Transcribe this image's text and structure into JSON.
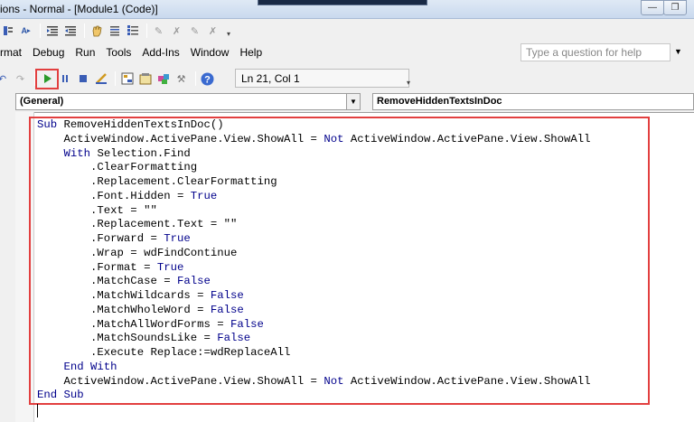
{
  "window": {
    "title": "ions - Normal - [Module1 (Code)]",
    "controls": [
      "minimize",
      "restore"
    ]
  },
  "menu": {
    "items": [
      "rmat",
      "Debug",
      "Run",
      "Tools",
      "Add-Ins",
      "Window",
      "Help"
    ]
  },
  "help": {
    "placeholder": "Type a question for help"
  },
  "status": {
    "position": "Ln 21, Col 1"
  },
  "combos": {
    "object": "(General)",
    "procedure": "RemoveHiddenTextsInDoc"
  },
  "code": {
    "lines": [
      [
        {
          "t": "Sub ",
          "k": true
        },
        {
          "t": "RemoveHiddenTextsInDoc()",
          "k": false
        }
      ],
      [
        {
          "t": "    ActiveWindow.ActivePane.View.ShowAll = ",
          "k": false
        },
        {
          "t": "Not",
          "k": true
        },
        {
          "t": " ActiveWindow.ActivePane.View.ShowAll",
          "k": false
        }
      ],
      [
        {
          "t": "    ",
          "k": false
        },
        {
          "t": "With",
          "k": true
        },
        {
          "t": " Selection.Find",
          "k": false
        }
      ],
      [
        {
          "t": "        .ClearFormatting",
          "k": false
        }
      ],
      [
        {
          "t": "        .Replacement.ClearFormatting",
          "k": false
        }
      ],
      [
        {
          "t": "        .Font.Hidden = ",
          "k": false
        },
        {
          "t": "True",
          "k": true
        }
      ],
      [
        {
          "t": "        .Text = \"\"",
          "k": false
        }
      ],
      [
        {
          "t": "        .Replacement.Text = \"\"",
          "k": false
        }
      ],
      [
        {
          "t": "        .Forward = ",
          "k": false
        },
        {
          "t": "True",
          "k": true
        }
      ],
      [
        {
          "t": "        .Wrap = wdFindContinue",
          "k": false
        }
      ],
      [
        {
          "t": "        .Format = ",
          "k": false
        },
        {
          "t": "True",
          "k": true
        }
      ],
      [
        {
          "t": "        .MatchCase = ",
          "k": false
        },
        {
          "t": "False",
          "k": true
        }
      ],
      [
        {
          "t": "        .MatchWildcards = ",
          "k": false
        },
        {
          "t": "False",
          "k": true
        }
      ],
      [
        {
          "t": "        .MatchWholeWord = ",
          "k": false
        },
        {
          "t": "False",
          "k": true
        }
      ],
      [
        {
          "t": "        .MatchAllWordForms = ",
          "k": false
        },
        {
          "t": "False",
          "k": true
        }
      ],
      [
        {
          "t": "        .MatchSoundsLike = ",
          "k": false
        },
        {
          "t": "False",
          "k": true
        }
      ],
      [
        {
          "t": "        .Execute Replace:=wdReplaceAll",
          "k": false
        }
      ],
      [
        {
          "t": "    ",
          "k": false
        },
        {
          "t": "End With",
          "k": true
        }
      ],
      [
        {
          "t": "    ActiveWindow.ActivePane.View.ShowAll = ",
          "k": false
        },
        {
          "t": "Not",
          "k": true
        },
        {
          "t": " ActiveWindow.ActivePane.View.ShowAll",
          "k": false
        }
      ],
      [
        {
          "t": "End Sub",
          "k": true
        }
      ]
    ]
  },
  "colors": {
    "keyword": "#00008b",
    "highlight": "#e23f3f"
  }
}
